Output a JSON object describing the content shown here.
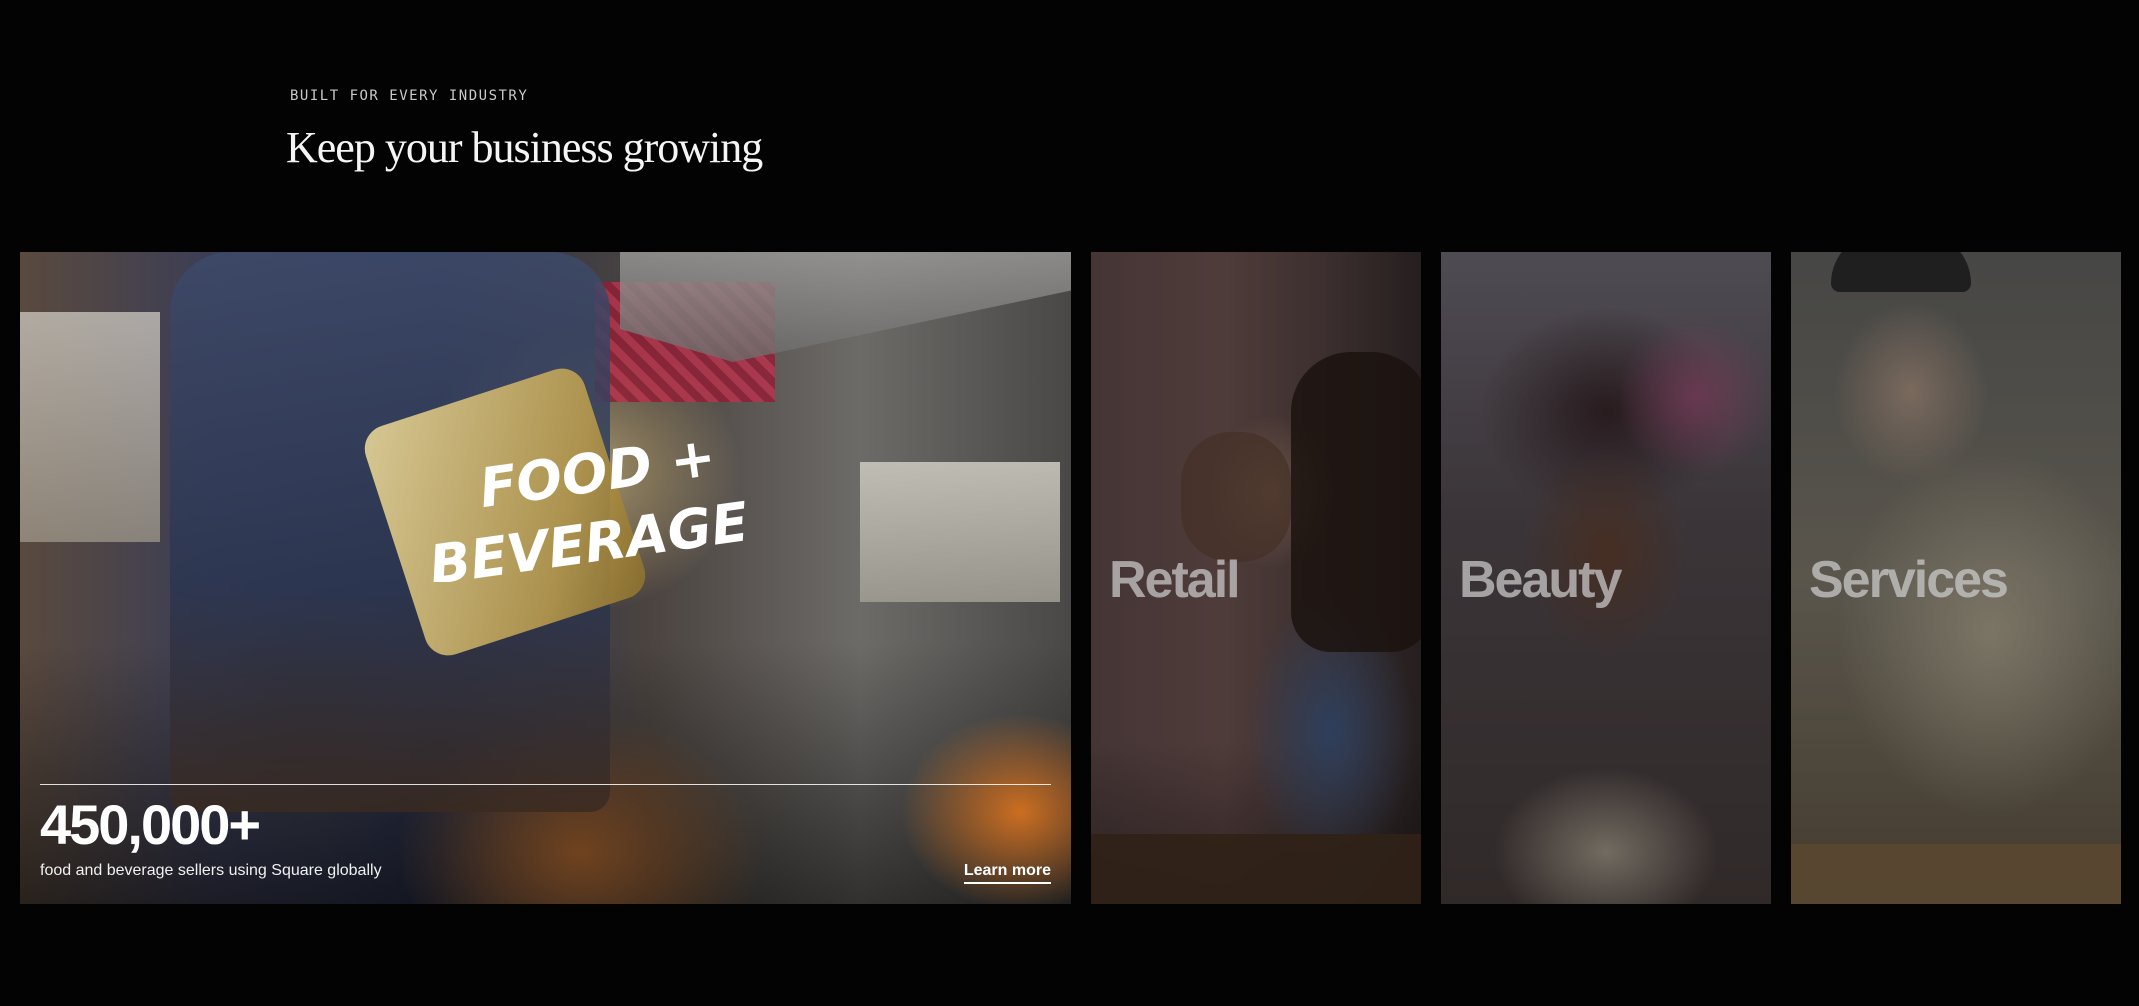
{
  "section": {
    "eyebrow": "BUILT FOR EVERY INDUSTRY",
    "title": "Keep your business growing"
  },
  "cards": {
    "featured": {
      "logo_text_line1": "FOOD +",
      "logo_text_line2": "BEVERAGE",
      "stat_value": "450,000+",
      "stat_caption": "food and beverage sellers using Square globally",
      "link_label": "Learn more"
    },
    "retail": {
      "label": "Retail"
    },
    "beauty": {
      "label": "Beauty"
    },
    "services": {
      "label": "Services"
    }
  },
  "colors": {
    "background": "#030303",
    "text": "#ffffff",
    "muted_label": "#cdcdcd"
  }
}
